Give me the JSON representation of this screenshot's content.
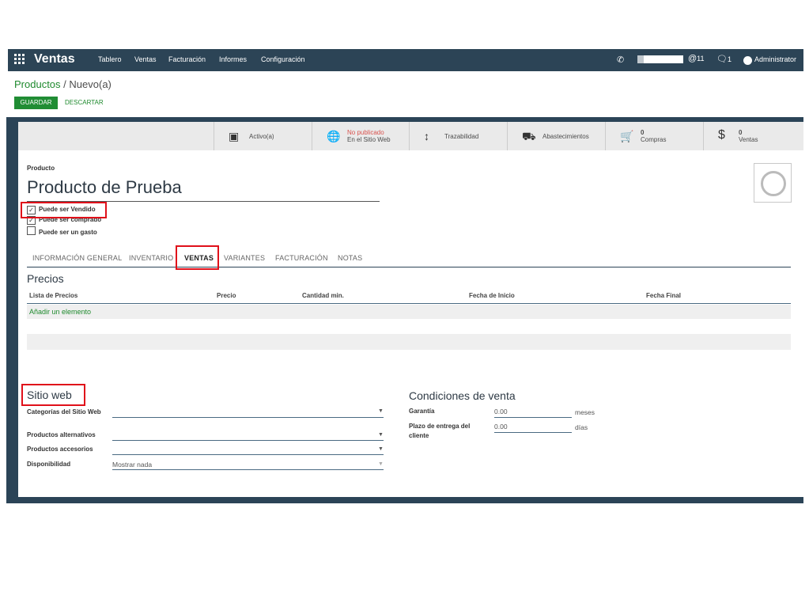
{
  "navbar": {
    "brand": "Ventas",
    "menu": [
      "Tablero",
      "Ventas",
      "Facturación",
      "Informes",
      "Configuración"
    ],
    "icons": {
      "apps": "grid-icon",
      "phone": "phone-icon",
      "mentions": "at-icon",
      "chat": "chat-icon"
    },
    "mentions_count": "11",
    "messages_count": "1",
    "user": "Administrator"
  },
  "breadcrumb": {
    "parent": "Productos",
    "separator": "/",
    "current": "Nuevo(a)"
  },
  "actions": {
    "save": "GUARDAR",
    "discard": "DESCARTAR"
  },
  "stat_buttons": [
    {
      "icon": "archive-icon",
      "line1": "Activo(a)",
      "line2": ""
    },
    {
      "icon": "globe-icon",
      "line1": "No publicado",
      "line2": "En el Sitio Web"
    },
    {
      "icon": "arrows-vertical-icon",
      "line1": "Trazabilidad",
      "line2": ""
    },
    {
      "icon": "truck-icon",
      "line1": "Abastecimientos",
      "line2": ""
    },
    {
      "icon": "cart-icon",
      "line1": "0",
      "line2": "Compras"
    },
    {
      "icon": "dollar-icon",
      "line1": "0",
      "line2": "Ventas"
    }
  ],
  "product": {
    "label": "Producto",
    "name": "Producto de Prueba",
    "checkboxes": [
      {
        "label": "Puede ser Vendido",
        "checked": true
      },
      {
        "label": "Puede ser comprado",
        "checked": true
      },
      {
        "label": "Puede ser un gasto",
        "checked": false
      }
    ]
  },
  "tabs": [
    "INFORMACIÓN GENERAL",
    "INVENTARIO",
    "VENTAS",
    "VARIANTES",
    "FACTURACIÓN",
    "NOTAS"
  ],
  "active_tab": "VENTAS",
  "pricelist": {
    "title": "Precios",
    "columns": [
      "Lista de Precios",
      "Precio",
      "Cantidad min.",
      "Fecha de Inicio",
      "Fecha Final"
    ],
    "add_item": "Añadir un elemento"
  },
  "website": {
    "title": "Sitio web",
    "fields": [
      {
        "label": "Categorías del Sitio Web",
        "value": ""
      },
      {
        "label": "Productos alternativos",
        "value": ""
      },
      {
        "label": "Productos accesorios",
        "value": ""
      },
      {
        "label": "Disponibilidad",
        "value": "Mostrar nada"
      }
    ]
  },
  "sale_conditions": {
    "title": "Condiciones de venta",
    "fields": [
      {
        "label": "Garantía",
        "value": "0.00",
        "unit": "meses"
      },
      {
        "label": "Plazo de entrega del cliente",
        "value": "0.00",
        "unit": "días"
      }
    ]
  },
  "colors": {
    "navbar": "#2c4456",
    "accent_green": "#208d34",
    "highlight_red": "#e0101a"
  }
}
